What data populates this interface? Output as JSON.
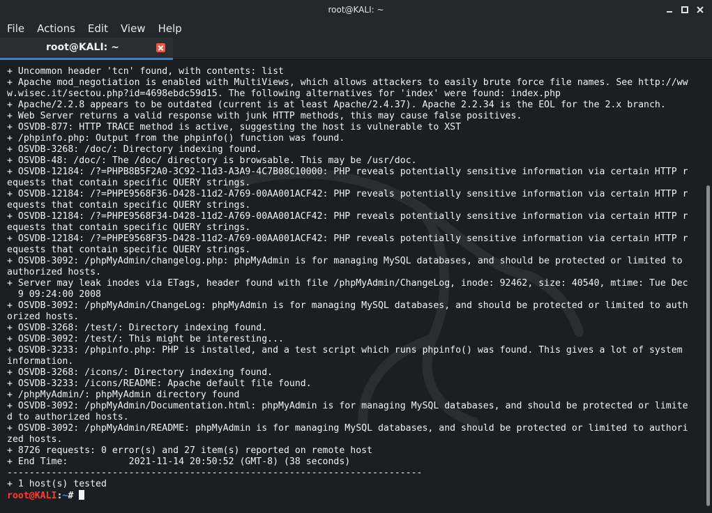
{
  "window": {
    "title": "root@KALI: ~",
    "tab_label": "root@KALI: ~"
  },
  "menu": {
    "items": [
      "File",
      "Actions",
      "Edit",
      "View",
      "Help"
    ]
  },
  "terminal": {
    "lines": [
      "+ Uncommon header 'tcn' found, with contents: list",
      "+ Apache mod_negotiation is enabled with MultiViews, which allows attackers to easily brute force file names. See http://ww",
      "w.wisec.it/sectou.php?id=4698ebdc59d15. The following alternatives for 'index' were found: index.php",
      "+ Apache/2.2.8 appears to be outdated (current is at least Apache/2.4.37). Apache 2.2.34 is the EOL for the 2.x branch.",
      "+ Web Server returns a valid response with junk HTTP methods, this may cause false positives.",
      "+ OSVDB-877: HTTP TRACE method is active, suggesting the host is vulnerable to XST",
      "+ /phpinfo.php: Output from the phpinfo() function was found.",
      "+ OSVDB-3268: /doc/: Directory indexing found.",
      "+ OSVDB-48: /doc/: The /doc/ directory is browsable. This may be /usr/doc.",
      "+ OSVDB-12184: /?=PHPB8B5F2A0-3C92-11d3-A3A9-4C7B08C10000: PHP reveals potentially sensitive information via certain HTTP r",
      "equests that contain specific QUERY strings.",
      "+ OSVDB-12184: /?=PHPE9568F36-D428-11d2-A769-00AA001ACF42: PHP reveals potentially sensitive information via certain HTTP r",
      "equests that contain specific QUERY strings.",
      "+ OSVDB-12184: /?=PHPE9568F34-D428-11d2-A769-00AA001ACF42: PHP reveals potentially sensitive information via certain HTTP r",
      "equests that contain specific QUERY strings.",
      "+ OSVDB-12184: /?=PHPE9568F35-D428-11d2-A769-00AA001ACF42: PHP reveals potentially sensitive information via certain HTTP r",
      "equests that contain specific QUERY strings.",
      "+ OSVDB-3092: /phpMyAdmin/changelog.php: phpMyAdmin is for managing MySQL databases, and should be protected or limited to",
      "authorized hosts.",
      "+ Server may leak inodes via ETags, header found with file /phpMyAdmin/ChangeLog, inode: 92462, size: 40540, mtime: Tue Dec",
      "  9 09:24:00 2008",
      "+ OSVDB-3092: /phpMyAdmin/ChangeLog: phpMyAdmin is for managing MySQL databases, and should be protected or limited to auth",
      "orized hosts.",
      "+ OSVDB-3268: /test/: Directory indexing found.",
      "+ OSVDB-3092: /test/: This might be interesting...",
      "+ OSVDB-3233: /phpinfo.php: PHP is installed, and a test script which runs phpinfo() was found. This gives a lot of system",
      "information.",
      "+ OSVDB-3268: /icons/: Directory indexing found.",
      "+ OSVDB-3233: /icons/README: Apache default file found.",
      "+ /phpMyAdmin/: phpMyAdmin directory found",
      "+ OSVDB-3092: /phpMyAdmin/Documentation.html: phpMyAdmin is for managing MySQL databases, and should be protected or limite",
      "d to authorized hosts.",
      "+ OSVDB-3092: /phpMyAdmin/README: phpMyAdmin is for managing MySQL databases, and should be protected or limited to authori",
      "zed hosts.",
      "+ 8726 requests: 0 error(s) and 27 item(s) reported on remote host",
      "+ End Time:           2021-11-14 20:50:52 (GMT-8) (38 seconds)",
      "---------------------------------------------------------------------------",
      "+ 1 host(s) tested"
    ],
    "prompt": {
      "user": "root@KALI",
      "separator": ":",
      "path": "~",
      "char": "# "
    }
  },
  "colors": {
    "background": "#1b1e22",
    "chrome": "#24272b",
    "tab_accent": "#2f84e8",
    "prompt_user": "#ff3b30",
    "prompt_path": "#3b8eea",
    "close_button": "#e55a44"
  }
}
